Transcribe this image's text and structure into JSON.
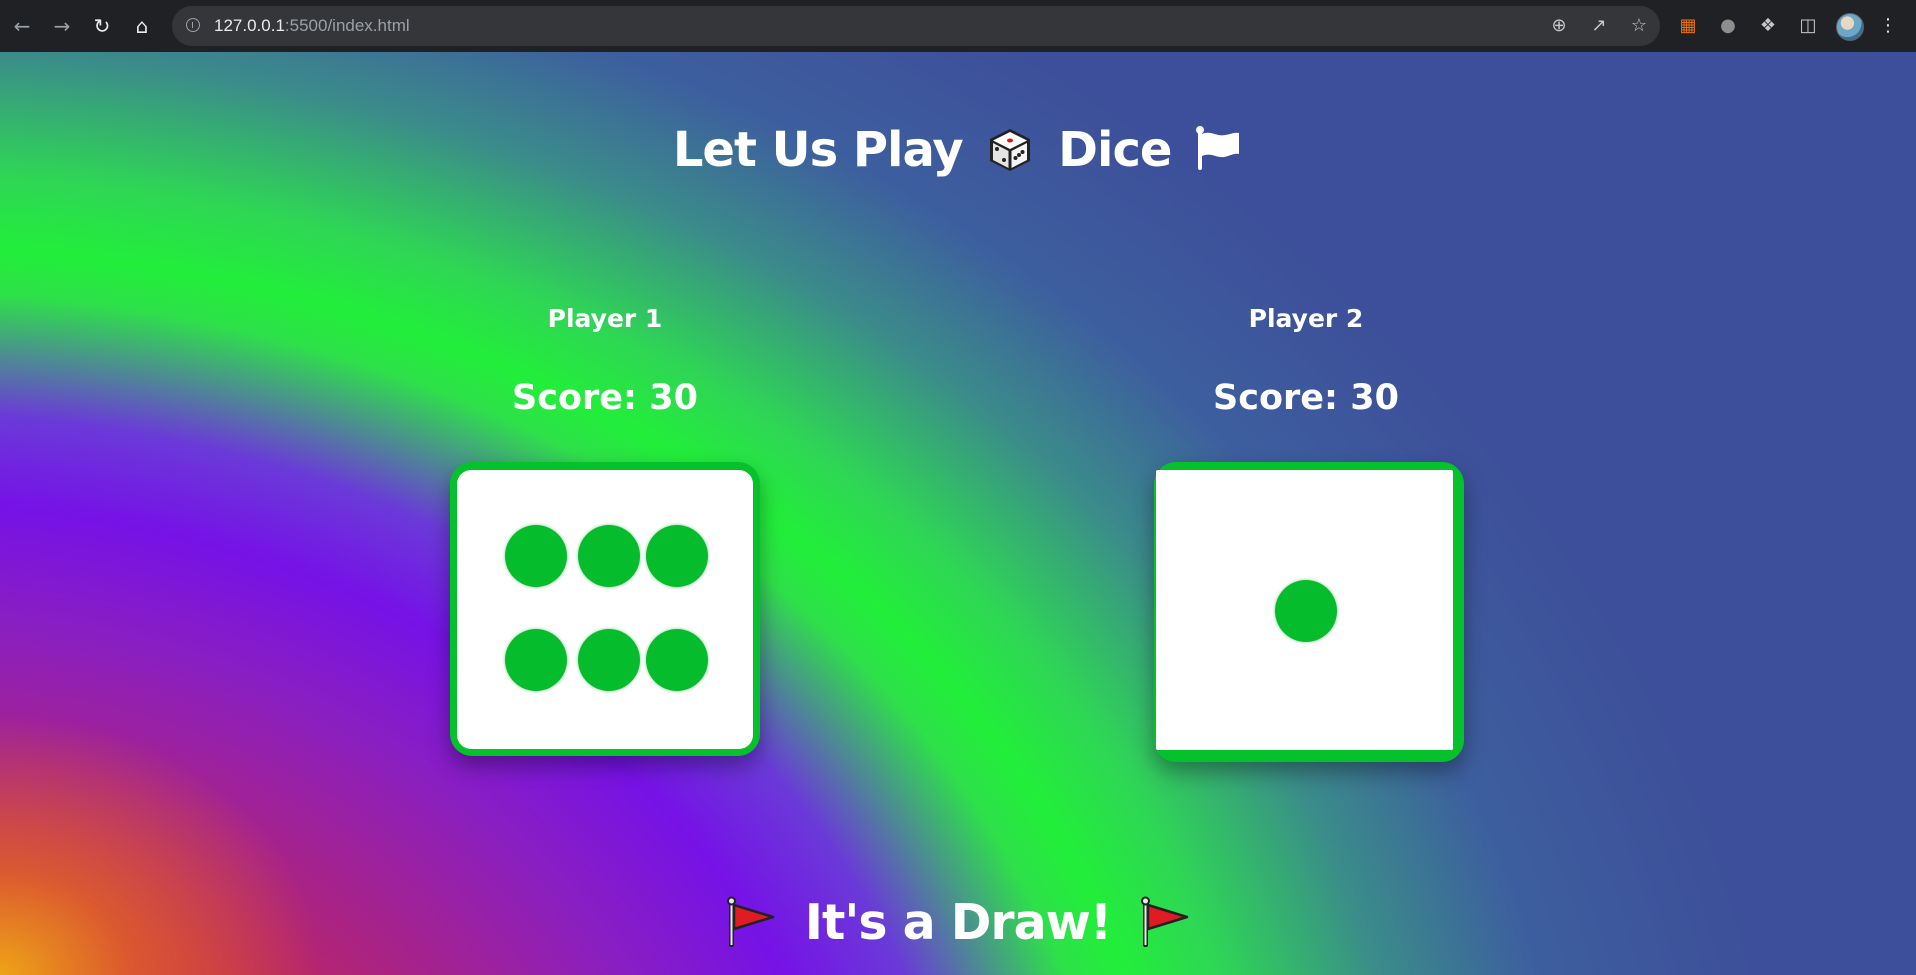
{
  "browser": {
    "url_host": "127.0.0.1",
    "url_rest": ":5500/index.html"
  },
  "game": {
    "title_part1": "Let Us Play",
    "title_part2": "Dice",
    "players": [
      {
        "name": "Player 1",
        "score_text": "Score: 30",
        "die_value": 6
      },
      {
        "name": "Player 2",
        "score_text": "Score: 30",
        "die_value": 1
      }
    ],
    "result": "It's a Draw!"
  },
  "colors": {
    "die_green": "#05c22c",
    "pip_green": "#05bd2c",
    "text": "#ffffff",
    "flag_red": "#e01b24"
  },
  "icons": {
    "title_die": "game-die-emoji",
    "title_flag": "white-flag-emoji",
    "result_flags": "triangular-flag-emoji"
  }
}
